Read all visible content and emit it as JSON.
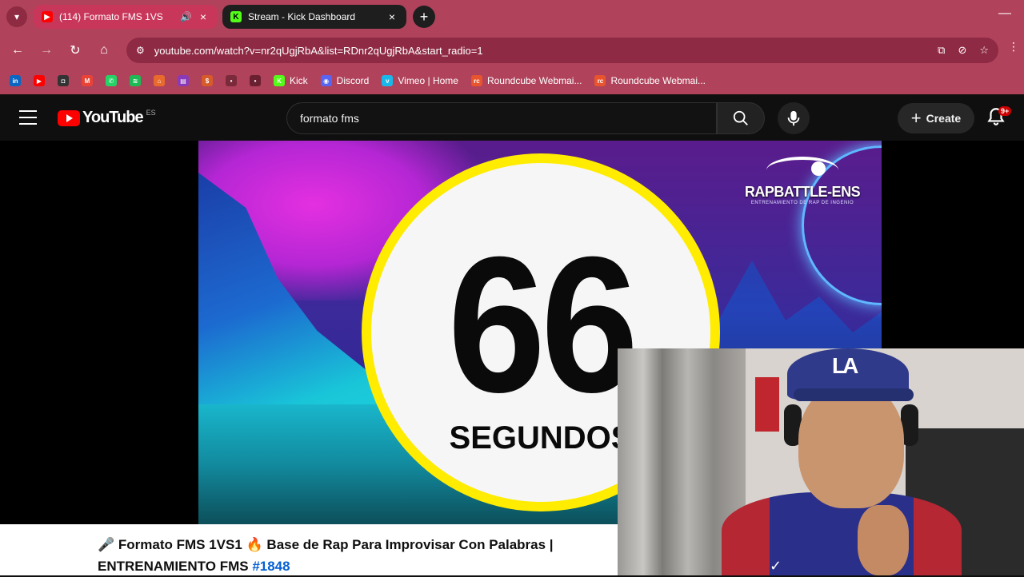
{
  "browser": {
    "tabs": [
      {
        "title": "(114) Formato FMS 1VS",
        "active": true,
        "favicon": "youtube-icon"
      },
      {
        "title": "Stream - Kick Dashboard",
        "active": false,
        "favicon": "kick-icon"
      }
    ],
    "url": "youtube.com/watch?v=nr2qUgjRbA&list=RDnr2qUgjRbA&start_radio=1",
    "bookmarks": [
      {
        "label": "",
        "icon": "linkedin-icon",
        "color": "#0a66c2",
        "glyph": "in"
      },
      {
        "label": "",
        "icon": "youtube-icon",
        "color": "#ff0000",
        "glyph": "▶"
      },
      {
        "label": "",
        "icon": "app-icon",
        "color": "#333333",
        "glyph": "◘"
      },
      {
        "label": "",
        "icon": "gmail-icon",
        "color": "#ea4335",
        "glyph": "M"
      },
      {
        "label": "",
        "icon": "whatsapp-icon",
        "color": "#25d366",
        "glyph": "✆"
      },
      {
        "label": "",
        "icon": "spotify-icon",
        "color": "#1db954",
        "glyph": "≋"
      },
      {
        "label": "",
        "icon": "app-icon",
        "color": "#e86a2c",
        "glyph": "⌂"
      },
      {
        "label": "",
        "icon": "app-icon",
        "color": "#8a3ab9",
        "glyph": "▤"
      },
      {
        "label": "",
        "icon": "app-icon",
        "color": "#d65a2a",
        "glyph": "$"
      },
      {
        "label": "",
        "icon": "app-icon",
        "color": "#7a2a3a",
        "glyph": "•"
      },
      {
        "label": "",
        "icon": "app-icon",
        "color": "#6a2030",
        "glyph": "•"
      },
      {
        "label": "Kick",
        "icon": "kick-icon",
        "color": "#53fc18",
        "glyph": "K"
      },
      {
        "label": "Discord",
        "icon": "discord-icon",
        "color": "#5865f2",
        "glyph": "◉"
      },
      {
        "label": "Vimeo | Home",
        "icon": "vimeo-icon",
        "color": "#1ab7ea",
        "glyph": "v"
      },
      {
        "label": "Roundcube Webmai...",
        "icon": "roundcube-icon",
        "color": "#e8542e",
        "glyph": "rc"
      },
      {
        "label": "Roundcube Webmai...",
        "icon": "roundcube-icon",
        "color": "#e8542e",
        "glyph": "rc"
      }
    ]
  },
  "youtube": {
    "logo_text": "YouTube",
    "country_code": "ES",
    "search_value": "formato fms",
    "create_label": "Create",
    "notification_count": "9+"
  },
  "video": {
    "countdown_number": "66",
    "countdown_label": "SEGUNDOS",
    "brand_title": "RAPBATTLE-ENS",
    "brand_subtitle": "ENTRENAMIENTO DE RAP DE INGENIO",
    "title_line1": "🎤 Formato FMS 1VS1 🔥 Base de Rap Para Improvisar Con Palabras |",
    "title_line2_text": "ENTRENAMIENTO FMS ",
    "title_hashtag": "#1848"
  },
  "webcam": {
    "cap_logo": "LA"
  },
  "colors": {
    "chrome": "#b0435b",
    "ring": "#ffec00",
    "youtube_red": "#ff0000",
    "link": "#065fd4"
  }
}
